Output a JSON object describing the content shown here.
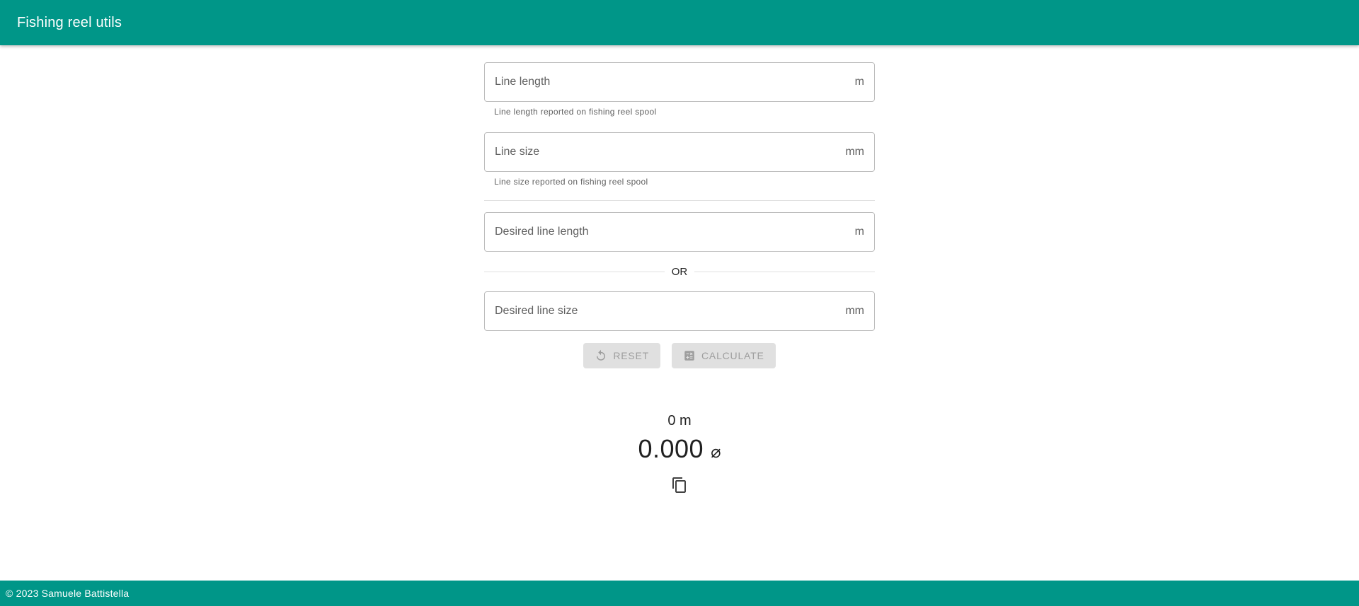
{
  "app": {
    "title": "Fishing reel utils"
  },
  "form": {
    "line_length": {
      "placeholder": "Line length",
      "value": "",
      "suffix": "m",
      "hint": "Line length reported on fishing reel spool"
    },
    "line_size": {
      "placeholder": "Line size",
      "value": "",
      "suffix": "mm",
      "hint": "Line size reported on fishing reel spool"
    },
    "desired_line_length": {
      "placeholder": "Desired line length",
      "value": "",
      "suffix": "m"
    },
    "separator_label": "OR",
    "desired_line_size": {
      "placeholder": "Desired line size",
      "value": "",
      "suffix": "mm"
    }
  },
  "actions": {
    "reset_label": "RESET",
    "reset_icon": "reset-icon",
    "calculate_label": "CALCULATE",
    "calculate_icon": "calculator-icon"
  },
  "result": {
    "length": "0 m",
    "size": "0.000",
    "size_symbol": "⌀",
    "copy_icon": "copy-icon"
  },
  "footer": {
    "copyright": "© 2023 Samuele Battistella"
  },
  "colors": {
    "primary": "#009688",
    "disabled_button_bg": "#e0e0e0",
    "disabled_button_text": "#9e9e9e"
  }
}
